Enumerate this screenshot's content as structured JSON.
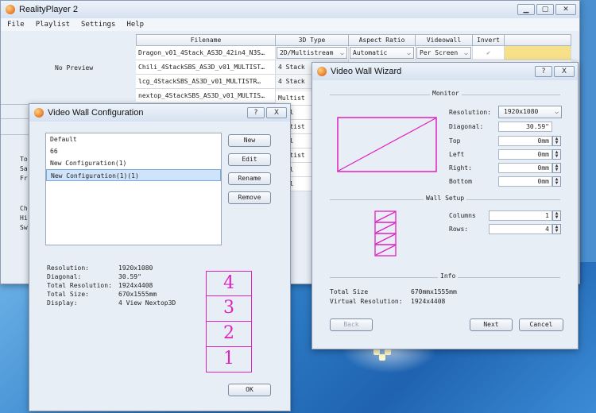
{
  "main_window": {
    "title": "RealityPlayer 2",
    "menu": [
      "File",
      "Playlist",
      "Settings",
      "Help"
    ],
    "no_preview": "No Preview",
    "columns": [
      "Filename",
      "3D Type",
      "Aspect Ratio",
      "Videowall",
      "Invert"
    ],
    "rows": [
      {
        "filename": "Dragon_v01_4Stack_AS3D_42in4_N3S…",
        "type": "2D/Multistream",
        "aspect": "Automatic",
        "wall": "Per Screen"
      },
      {
        "filename": "Chili_4StackSBS_AS3D_v01_MULTIST…",
        "type": "4 Stack"
      },
      {
        "filename": "lcg_4StackSBS_AS3D_v01_MULTISTR…",
        "type": "4 Stack"
      },
      {
        "filename": "nextop_4StackSBS_AS3D_v01_MULTIS…",
        "type": "4 Stack"
      }
    ],
    "partial_types": [
      "Multist",
      "evel",
      "Multist",
      "evel",
      "Multist",
      "evel",
      "evel"
    ],
    "left_labels": [
      "To",
      "Sa",
      "Fr",
      "Ch",
      "Hi",
      "Sw"
    ]
  },
  "config_window": {
    "title": "Video Wall Configuration",
    "help": "?",
    "close": "X",
    "list": [
      "Default",
      "66",
      "New Configuration(1)",
      "New Configuration(1)(1)"
    ],
    "buttons": [
      "New",
      "Edit",
      "Rename",
      "Remove"
    ],
    "info": [
      {
        "label": "Resolution:",
        "value": "1920x1080"
      },
      {
        "label": "Diagonal:",
        "value": "30.59\""
      },
      {
        "label": "Total Resolution:",
        "value": "1924x4408"
      },
      {
        "label": "Total Size:",
        "value": "670x1555mm"
      },
      {
        "label": "Display:",
        "value": "4 View Nextop3D"
      }
    ],
    "stack": [
      "4",
      "3",
      "2",
      "1"
    ],
    "ok": "OK"
  },
  "wizard_window": {
    "title": "Video Wall Wizard",
    "help": "?",
    "close": "X",
    "monitor_section": "Monitor",
    "resolution_label": "Resolution:",
    "resolution_value": "1920x1080",
    "fields": [
      {
        "label": "Diagonal:",
        "value": "30.59\""
      },
      {
        "label": "Top",
        "value": "0mm"
      },
      {
        "label": "Left",
        "value": "0mm"
      },
      {
        "label": "Right:",
        "value": "0mm"
      },
      {
        "label": "Bottom",
        "value": "0mm"
      }
    ],
    "wall_section": "Wall Setup",
    "columns_label": "Columns",
    "columns_value": "1",
    "rows_label": "Rows:",
    "rows_value": "4",
    "info_section": "Info",
    "total_size_label": "Total Size",
    "total_size_value": "670mmx1555mm",
    "virtual_res_label": "Virtual Resolution:",
    "virtual_res_value": "1924x4408",
    "back": "Back",
    "next": "Next",
    "cancel": "Cancel"
  },
  "colors": {
    "magenta": "#e020c0",
    "selection": "#cfe3fb",
    "highlight": "#f6e08a"
  }
}
